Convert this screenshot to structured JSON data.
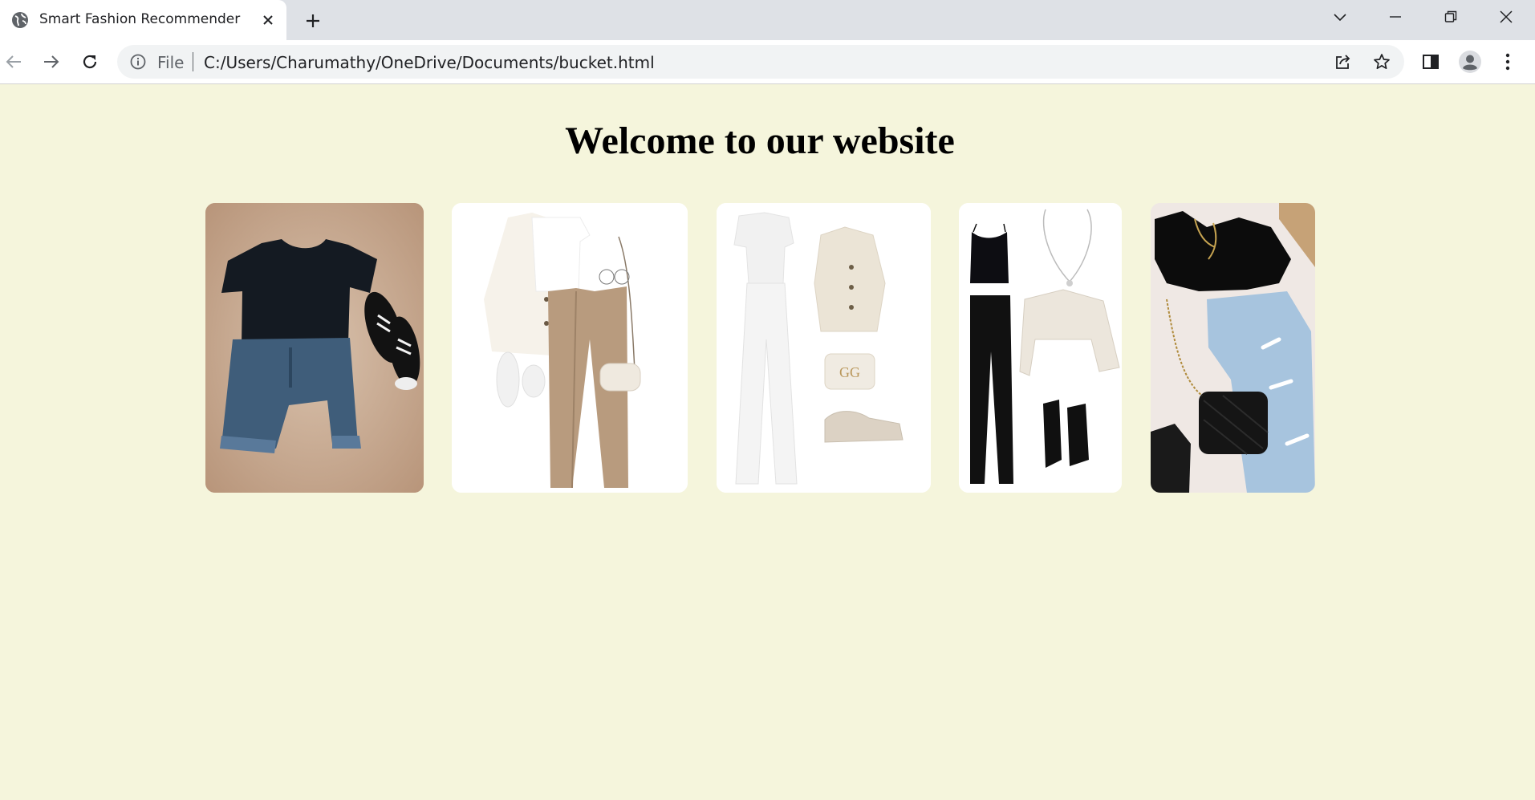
{
  "browser": {
    "tab_title": "Smart Fashion Recommender",
    "url_scheme": "File",
    "url": "C:/Users/Charumathy/OneDrive/Documents/bucket.html",
    "icons": [
      "globe-icon",
      "close-icon",
      "plus-icon",
      "chevron-down-icon",
      "minimize-icon",
      "restore-icon",
      "window-close-icon",
      "back-icon",
      "forward-icon",
      "reload-icon",
      "info-icon",
      "share-icon",
      "star-icon",
      "side-panel-icon",
      "profile-icon",
      "kebab-menu-icon"
    ]
  },
  "page": {
    "heading": "Welcome to our website",
    "background": "#f5f5dc",
    "outfits": [
      {
        "name": "outfit-1",
        "description": "black tee, denim shorts, black sneakers"
      },
      {
        "name": "outfit-2",
        "description": "cream cardigan, beige trousers, white sneakers, bag"
      },
      {
        "name": "outfit-3",
        "description": "white tee, white trousers, cardigan, bag, sneakers"
      },
      {
        "name": "outfit-4",
        "description": "black crop top, black trousers, cardigan, boots, necklace"
      },
      {
        "name": "outfit-5",
        "description": "black top, ripped jeans, black bag, boots"
      }
    ]
  }
}
